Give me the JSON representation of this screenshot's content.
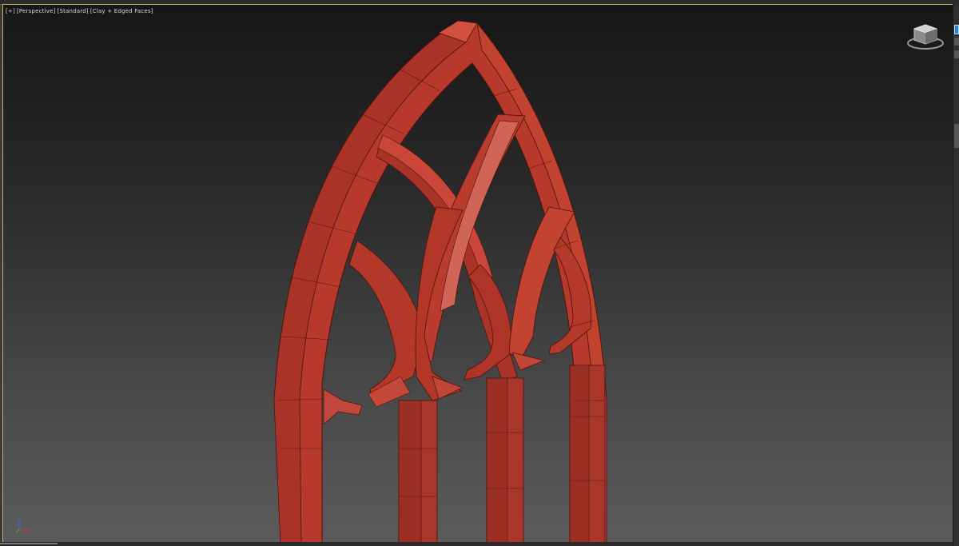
{
  "viewport": {
    "label_plus": "[+]",
    "label_view": "[Perspective]",
    "label_shading": "[Standard]",
    "label_mode": "[Clay + Edged Faces]"
  },
  "icons": {
    "viewcube": "viewcube-icon",
    "axis": "axis-tripod-icon"
  },
  "colors": {
    "model_fill": "#b5392b",
    "model_light": "#cf4c3d",
    "model_dark": "#7b2218",
    "wire": "#4a140e",
    "viewport_border": "#c9b65a",
    "panel_accent": "#2f7fd0"
  }
}
